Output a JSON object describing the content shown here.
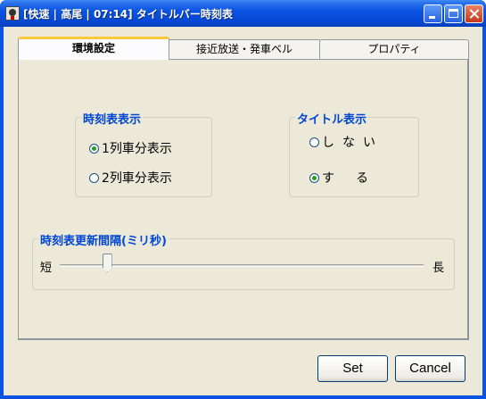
{
  "window": {
    "title": "[快速 | 高尾 | 07:14] タイトルバー時刻表"
  },
  "tabs": [
    {
      "label": "環境設定",
      "active": true
    },
    {
      "label": "接近放送・発車ベル",
      "active": false
    },
    {
      "label": "プロパティ",
      "active": false
    }
  ],
  "timetable_display": {
    "legend": "時刻表表示",
    "options": [
      {
        "label": "1列車分表示",
        "selected": true
      },
      {
        "label": "2列車分表示",
        "selected": false
      }
    ]
  },
  "title_display": {
    "legend": "タイトル表示",
    "options": [
      {
        "label": "しない",
        "selected": false
      },
      {
        "label": "する",
        "selected": true
      }
    ]
  },
  "update_interval": {
    "legend": "時刻表更新間隔(ミリ秒)",
    "min_label": "短",
    "max_label": "長",
    "level_fraction": 0.12
  },
  "buttons": {
    "set": "Set",
    "cancel": "Cancel"
  }
}
